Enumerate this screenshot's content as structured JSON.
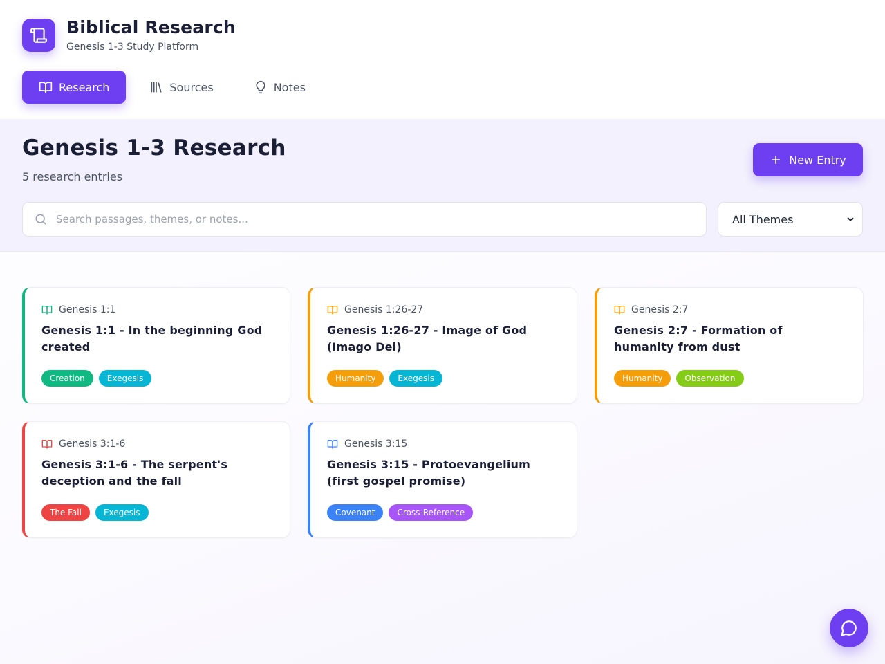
{
  "brand": {
    "title": "Biblical Research",
    "subtitle": "Genesis 1-3 Study Platform",
    "logo_icon": "scroll-icon"
  },
  "nav": [
    {
      "label": "Research",
      "icon": "book-open-icon",
      "active": true
    },
    {
      "label": "Sources",
      "icon": "library-icon",
      "active": false
    },
    {
      "label": "Notes",
      "icon": "lightbulb-icon",
      "active": false
    }
  ],
  "page": {
    "title": "Genesis 1-3 Research",
    "count": "5 research entries"
  },
  "new_entry": {
    "label": "New Entry",
    "icon": "plus-icon"
  },
  "search": {
    "placeholder": "Search passages, themes, or notes...",
    "value": ""
  },
  "theme_filter": {
    "selected": "All Themes"
  },
  "entries": [
    {
      "ref": "Genesis 1:1",
      "title": "Genesis 1:1 - In the beginning God created",
      "accent": "#10b981",
      "tags": [
        {
          "label": "Creation",
          "color": "#10b981"
        },
        {
          "label": "Exegesis",
          "color": "#06b6d4"
        }
      ]
    },
    {
      "ref": "Genesis 1:26-27",
      "title": "Genesis 1:26-27 - Image of God (Imago Dei)",
      "accent": "#f59e0b",
      "tags": [
        {
          "label": "Humanity",
          "color": "#f59e0b"
        },
        {
          "label": "Exegesis",
          "color": "#06b6d4"
        }
      ]
    },
    {
      "ref": "Genesis 2:7",
      "title": "Genesis 2:7 - Formation of humanity from dust",
      "accent": "#f59e0b",
      "tags": [
        {
          "label": "Humanity",
          "color": "#f59e0b"
        },
        {
          "label": "Observation",
          "color": "#84cc16"
        }
      ]
    },
    {
      "ref": "Genesis 3:1-6",
      "title": "Genesis 3:1-6 - The serpent's deception and the fall",
      "accent": "#ef4444",
      "tags": [
        {
          "label": "The Fall",
          "color": "#ef4444"
        },
        {
          "label": "Exegesis",
          "color": "#06b6d4"
        }
      ]
    },
    {
      "ref": "Genesis 3:15",
      "title": "Genesis 3:15 - Protoevangelium (first gospel promise)",
      "accent": "#3b82f6",
      "tags": [
        {
          "label": "Covenant",
          "color": "#3b82f6"
        },
        {
          "label": "Cross-Reference",
          "color": "#a855f7"
        }
      ]
    }
  ],
  "fab": {
    "icon": "chat-bubble-icon"
  }
}
